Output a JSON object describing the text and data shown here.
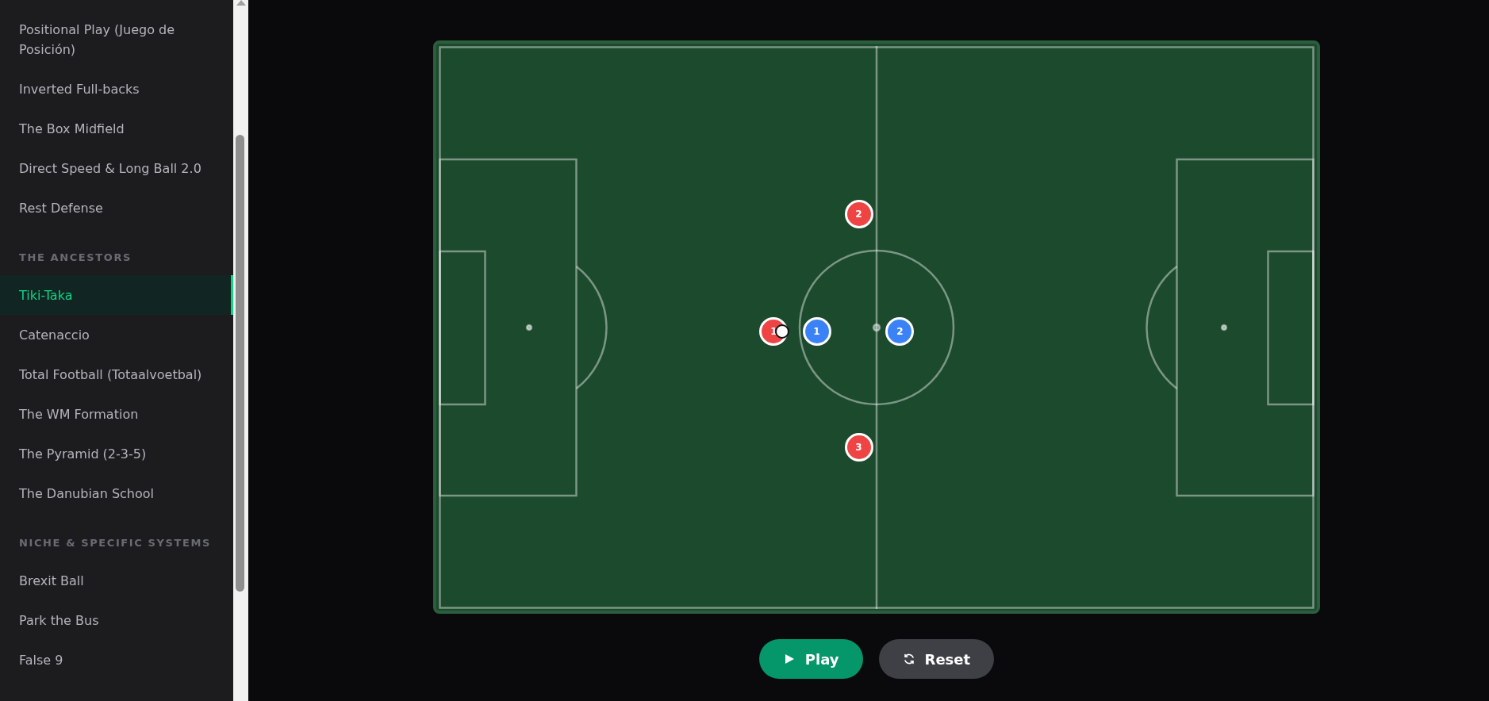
{
  "sidebar": {
    "sections": [
      {
        "items": [
          {
            "label": "Positional Play (Juego de Posición)",
            "selected": false
          },
          {
            "label": "Inverted Full-backs",
            "selected": false
          },
          {
            "label": "The Box Midfield",
            "selected": false
          },
          {
            "label": "Direct Speed & Long Ball 2.0",
            "selected": false
          },
          {
            "label": "Rest Defense",
            "selected": false
          }
        ]
      },
      {
        "title": "THE ANCESTORS",
        "items": [
          {
            "label": "Tiki-Taka",
            "selected": true
          },
          {
            "label": "Catenaccio",
            "selected": false
          },
          {
            "label": "Total Football (Totaalvoetbal)",
            "selected": false
          },
          {
            "label": "The WM Formation",
            "selected": false
          },
          {
            "label": "The Pyramid (2-3-5)",
            "selected": false
          },
          {
            "label": "The Danubian School",
            "selected": false
          }
        ]
      },
      {
        "title": "NICHE & SPECIFIC SYSTEMS",
        "items": [
          {
            "label": "Brexit Ball",
            "selected": false
          },
          {
            "label": "Park the Bus",
            "selected": false
          },
          {
            "label": "False 9",
            "selected": false
          }
        ]
      }
    ]
  },
  "pitch": {
    "players": [
      {
        "number": "1",
        "color": "#ef4444",
        "has_ball": true
      },
      {
        "number": "1",
        "color": "#3b82f6",
        "has_ball": false
      },
      {
        "number": "2",
        "color": "#3b82f6",
        "has_ball": false
      },
      {
        "number": "2",
        "color": "#ef4444",
        "has_ball": false
      },
      {
        "number": "3",
        "color": "#ef4444",
        "has_ball": false
      }
    ]
  },
  "controls": [
    {
      "kind": "play",
      "label": "Play"
    },
    {
      "kind": "reset",
      "label": "Reset"
    }
  ]
}
